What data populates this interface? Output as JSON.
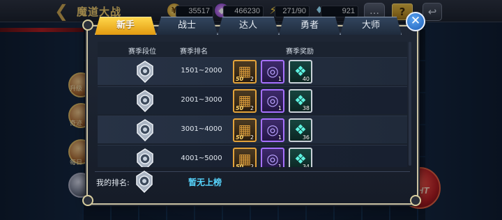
{
  "header": {
    "title": "魔道大战",
    "resources": [
      {
        "name": "gold-coin",
        "value": "35517"
      },
      {
        "name": "gem",
        "value": "466230"
      },
      {
        "name": "energy",
        "value": "271/90"
      },
      {
        "name": "diamond",
        "value": "921"
      }
    ],
    "help_label": "?"
  },
  "background": {
    "side_labels": [
      "升级",
      "奇迹",
      "每日"
    ],
    "fight_label": "HT"
  },
  "tabs": [
    {
      "label": "新手",
      "active": true
    },
    {
      "label": "战士",
      "active": false
    },
    {
      "label": "达人",
      "active": false
    },
    {
      "label": "勇者",
      "active": false
    },
    {
      "label": "大师",
      "active": false
    }
  ],
  "table": {
    "headers": {
      "tier": "赛季段位",
      "rank": "赛季排名",
      "reward": "赛季奖励"
    },
    "rows": [
      {
        "rank": "1501~2000",
        "rewards": [
          {
            "type": "chest",
            "level": "50",
            "qty": "2"
          },
          {
            "type": "orb",
            "qty": "1"
          },
          {
            "type": "crystal",
            "qty": "40"
          }
        ]
      },
      {
        "rank": "2001~3000",
        "rewards": [
          {
            "type": "chest",
            "level": "50",
            "qty": "2"
          },
          {
            "type": "orb",
            "qty": "1"
          },
          {
            "type": "crystal",
            "qty": "38"
          }
        ]
      },
      {
        "rank": "3001~4000",
        "rewards": [
          {
            "type": "chest",
            "level": "50",
            "qty": "2"
          },
          {
            "type": "orb",
            "qty": "1"
          },
          {
            "type": "crystal",
            "qty": "36"
          }
        ]
      },
      {
        "rank": "4001~5000",
        "rewards": [
          {
            "type": "chest",
            "level": "50",
            "qty": "2"
          },
          {
            "type": "orb",
            "qty": "1"
          },
          {
            "type": "crystal",
            "qty": "34"
          }
        ]
      }
    ]
  },
  "footer": {
    "my_rank_label": "我的排名:",
    "my_rank_value": "暂无上榜"
  },
  "colors": {
    "active_tab": "#f4b11e",
    "accent_blue": "#57d6ff",
    "frame": "#c9c1a2"
  }
}
